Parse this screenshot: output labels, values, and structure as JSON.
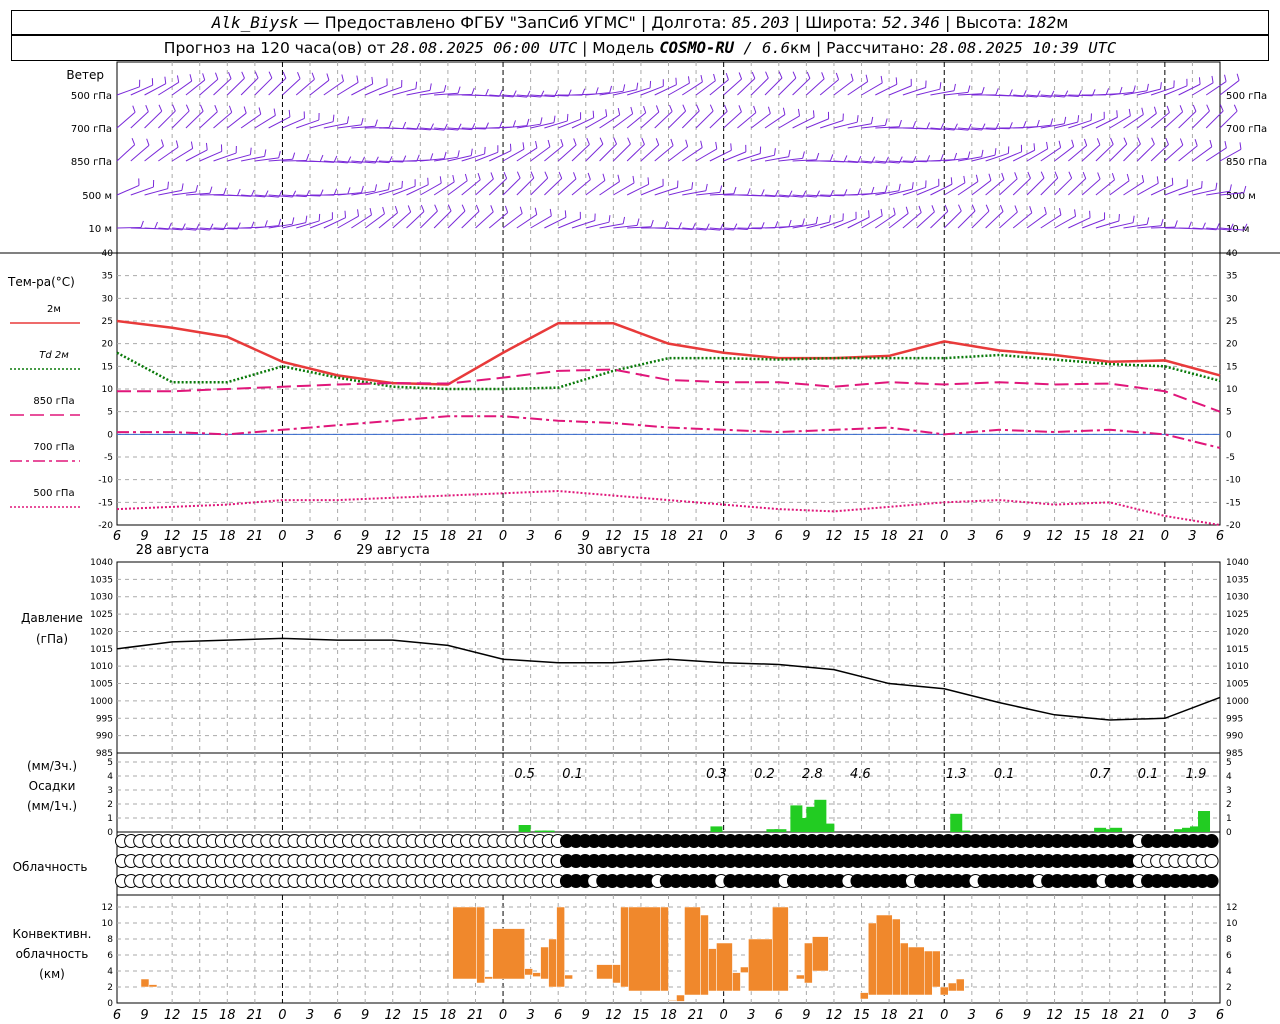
{
  "header": {
    "station": "Alk_Biysk",
    "dash": " — ",
    "provider": "Предоставлено ФГБУ \"ЗапСиб УГМС\"",
    "sep": " | ",
    "lon_label": "Долгота: ",
    "lon": "85.203",
    "lat_label": "Широта: ",
    "lat": "52.346",
    "alt_label": "Высота: ",
    "alt": "182",
    "alt_unit": "м",
    "forecast_prefix": "Прогноз на 120 часа(ов) от ",
    "forecast_time": "28.08.2025 06:00 UTC",
    "model_prefix": "Модель ",
    "model": "COSMO-RU",
    "model_res": " / 6.6",
    "model_res_unit": "км",
    "calc_prefix": "Рассчитано: ",
    "calc_time": "28.08.2025 10:39 UTC"
  },
  "chart_data": [
    {
      "type": "wind-barbs",
      "title": "Ветер",
      "levels": [
        "500 гПа",
        "700 гПа",
        "850 гПа",
        "500 м",
        "10 м"
      ],
      "color": "#7a29d9"
    },
    {
      "type": "line",
      "title": "Тем-ра(°C)",
      "ylim": [
        -20,
        40
      ],
      "yticks": [
        40,
        35,
        30,
        25,
        20,
        15,
        10,
        5,
        0,
        -5,
        -10,
        -15,
        -20
      ],
      "x_hours": [
        0,
        6,
        12,
        18,
        24,
        30,
        36,
        42,
        48,
        54,
        60,
        66,
        72,
        78,
        84,
        90,
        96,
        102,
        108,
        114,
        120
      ],
      "series": [
        {
          "name": "2м",
          "color": "#e83a3a",
          "style": "solid",
          "values": [
            25,
            23.5,
            21.5,
            16,
            13,
            11.3,
            11,
            18,
            24.5,
            24.5,
            20,
            18,
            16.8,
            16.8,
            17.3,
            20.5,
            18.5,
            17.5,
            16,
            16.3,
            13
          ]
        },
        {
          "name": "Td 2м",
          "color": "#0a7a0a",
          "style": "dotted",
          "values": [
            18,
            11.5,
            11.5,
            15,
            12.5,
            10.5,
            10,
            10,
            10.3,
            14,
            16.8,
            16.8,
            16.5,
            16.8,
            16.8,
            16.8,
            17.5,
            16.5,
            15.5,
            15,
            11.8
          ]
        },
        {
          "name": "850 гПа",
          "color": "#e0167a",
          "style": "dash",
          "values": [
            9.5,
            9.5,
            10,
            10.5,
            11,
            11.3,
            11.2,
            12.5,
            14,
            14.3,
            12,
            11.5,
            11.5,
            10.5,
            11.5,
            11,
            11.5,
            11,
            11.2,
            9.5,
            5
          ]
        },
        {
          "name": "700 гПа",
          "color": "#e0167a",
          "style": "dashdot",
          "values": [
            0.5,
            0.5,
            0,
            1,
            2,
            3,
            4,
            4,
            3,
            2.5,
            1.5,
            1,
            0.5,
            1,
            1.5,
            0,
            1,
            0.5,
            1,
            0,
            -3
          ]
        },
        {
          "name": "500 гПа",
          "color": "#e0167a",
          "style": "dotted",
          "values": [
            -16.5,
            -16,
            -15.5,
            -14.5,
            -14.5,
            -14,
            -13.5,
            -13,
            -12.5,
            -13.5,
            -14.5,
            -15.5,
            -16.5,
            -17,
            -16,
            -15,
            -14.5,
            -15.5,
            -15,
            -18,
            -20
          ]
        }
      ]
    },
    {
      "type": "line",
      "title": "Давление",
      "unit": "(гПа)",
      "ylim": [
        985,
        1040
      ],
      "yticks": [
        1040,
        1035,
        1030,
        1025,
        1020,
        1015,
        1010,
        1005,
        1000,
        995,
        990,
        985
      ],
      "series": [
        {
          "name": "",
          "color": "#000000",
          "values": [
            1015,
            1017,
            1017.5,
            1018,
            1017.5,
            1017.5,
            1016,
            1012,
            1011,
            1011,
            1012,
            1011,
            1010.5,
            1009,
            1005,
            1003.5,
            999.5,
            996,
            994.5,
            995,
            1001
          ]
        }
      ]
    },
    {
      "type": "bar",
      "title": "Осадки",
      "unit_top": "(мм/3ч.)",
      "unit_bottom": "(мм/1ч.)",
      "ylim": [
        0,
        5
      ],
      "yticks": [
        5,
        4,
        3,
        2,
        1,
        0
      ],
      "color": "#22cc22",
      "totals": [
        {
          "hour": 57,
          "label": "0.5"
        },
        {
          "hour": 63,
          "label": "0.1"
        },
        {
          "hour": 81,
          "label": "0.3"
        },
        {
          "hour": 87,
          "label": "0.2"
        },
        {
          "hour": 93,
          "label": "2.8"
        },
        {
          "hour": 99,
          "label": "4.6"
        },
        {
          "hour": 111,
          "label": "1.3"
        },
        {
          "hour": 117,
          "label": "0.1"
        },
        {
          "hour": 129,
          "label": "0.7"
        },
        {
          "hour": 135,
          "label": "0.1"
        },
        {
          "hour": 141,
          "label": "1.9"
        }
      ],
      "bars": [
        {
          "hour": 57,
          "value": 0.5
        },
        {
          "hour": 59,
          "value": 0.1
        },
        {
          "hour": 60,
          "value": 0.1
        },
        {
          "hour": 81,
          "value": 0.4
        },
        {
          "hour": 88,
          "value": 0.2
        },
        {
          "hour": 89,
          "value": 0.2
        },
        {
          "hour": 91,
          "value": 1.9
        },
        {
          "hour": 92,
          "value": 1.0
        },
        {
          "hour": 93,
          "value": 1.8
        },
        {
          "hour": 94,
          "value": 2.3
        },
        {
          "hour": 95,
          "value": 0.6
        },
        {
          "hour": 111,
          "value": 1.3
        },
        {
          "hour": 112,
          "value": 0.1
        },
        {
          "hour": 129,
          "value": 0.3
        },
        {
          "hour": 130,
          "value": 0.2
        },
        {
          "hour": 131,
          "value": 0.3
        },
        {
          "hour": 139,
          "value": 0.2
        },
        {
          "hour": 140,
          "value": 0.3
        },
        {
          "hour": 141,
          "value": 0.4
        },
        {
          "hour": 142,
          "value": 1.5
        }
      ]
    },
    {
      "type": "cloud-symbols",
      "title": "Облачность",
      "rows": 3,
      "color": "#000000"
    },
    {
      "type": "bar",
      "title": "Конвективн.\nоблачность\n(км)",
      "ylim": [
        0,
        13
      ],
      "yticks": [
        12,
        10,
        8,
        6,
        4,
        2,
        0
      ],
      "color": "#f0882c",
      "bars": [
        {
          "start": 9,
          "end": 10,
          "bottom": 2,
          "top": 3
        },
        {
          "start": 10,
          "end": 11,
          "bottom": 2,
          "top": 2.3
        },
        {
          "start": 48,
          "end": 51,
          "bottom": 3,
          "top": 12
        },
        {
          "start": 51,
          "end": 52,
          "bottom": 2.5,
          "top": 12
        },
        {
          "start": 52,
          "end": 53,
          "bottom": 3,
          "top": 3.3
        },
        {
          "start": 53,
          "end": 57,
          "bottom": 3,
          "top": 9.3
        },
        {
          "start": 57,
          "end": 58,
          "bottom": 3.5,
          "top": 4.3
        },
        {
          "start": 58,
          "end": 59,
          "bottom": 3.3,
          "top": 3.8
        },
        {
          "start": 59,
          "end": 60,
          "bottom": 3,
          "top": 7
        },
        {
          "start": 60,
          "end": 61,
          "bottom": 2,
          "top": 8
        },
        {
          "start": 61,
          "end": 62,
          "bottom": 2,
          "top": 12
        },
        {
          "start": 62,
          "end": 63,
          "bottom": 3,
          "top": 3.5
        },
        {
          "start": 66,
          "end": 68,
          "bottom": 3,
          "top": 4.8
        },
        {
          "start": 68,
          "end": 69,
          "bottom": 2.5,
          "top": 4.8
        },
        {
          "start": 69,
          "end": 70,
          "bottom": 2,
          "top": 12
        },
        {
          "start": 70,
          "end": 74,
          "bottom": 1.5,
          "top": 12
        },
        {
          "start": 74,
          "end": 75,
          "bottom": 1.5,
          "top": 12
        },
        {
          "start": 75,
          "end": 76,
          "bottom": 0.3,
          "top": 0.4
        },
        {
          "start": 76,
          "end": 77,
          "bottom": 0.2,
          "top": 1
        },
        {
          "start": 77,
          "end": 79,
          "bottom": 1,
          "top": 12
        },
        {
          "start": 79,
          "end": 80,
          "bottom": 1,
          "top": 11
        },
        {
          "start": 80,
          "end": 81,
          "bottom": 1.5,
          "top": 6.8
        },
        {
          "start": 81,
          "end": 83,
          "bottom": 1.5,
          "top": 7.5
        },
        {
          "start": 83,
          "end": 84,
          "bottom": 1.5,
          "top": 3.8
        },
        {
          "start": 84,
          "end": 85,
          "bottom": 3.8,
          "top": 4.5
        },
        {
          "start": 85,
          "end": 88,
          "bottom": 1.5,
          "top": 8
        },
        {
          "start": 88,
          "end": 90,
          "bottom": 1.5,
          "top": 12
        },
        {
          "start": 91,
          "end": 92,
          "bottom": 3,
          "top": 3.5
        },
        {
          "start": 92,
          "end": 93,
          "bottom": 2.5,
          "top": 7.5
        },
        {
          "start": 93,
          "end": 95,
          "bottom": 4,
          "top": 8.3
        },
        {
          "start": 99,
          "end": 100,
          "bottom": 0.5,
          "top": 1.3
        },
        {
          "start": 100,
          "end": 101,
          "bottom": 1,
          "top": 10
        },
        {
          "start": 101,
          "end": 103,
          "bottom": 1,
          "top": 11
        },
        {
          "start": 103,
          "end": 104,
          "bottom": 1,
          "top": 10.5
        },
        {
          "start": 104,
          "end": 105,
          "bottom": 1,
          "top": 7.5
        },
        {
          "start": 105,
          "end": 107,
          "bottom": 1,
          "top": 7
        },
        {
          "start": 107,
          "end": 108,
          "bottom": 1,
          "top": 6.5
        },
        {
          "start": 108,
          "end": 109,
          "bottom": 2,
          "top": 6.5
        },
        {
          "start": 109,
          "end": 110,
          "bottom": 1,
          "top": 2
        },
        {
          "start": 110,
          "end": 111,
          "bottom": 1.5,
          "top": 2.5
        },
        {
          "start": 111,
          "end": 112,
          "bottom": 1.5,
          "top": 3
        }
      ]
    }
  ],
  "time_axis": {
    "hour_labels": [
      "6",
      "9",
      "12",
      "15",
      "18",
      "21",
      "0",
      "3",
      "6",
      "9",
      "12",
      "15",
      "18",
      "21",
      "0",
      "3",
      "6",
      "9",
      "12",
      "15",
      "18",
      "21",
      "0",
      "3",
      "6",
      "9",
      "12",
      "15",
      "18",
      "21",
      "0",
      "3",
      "6",
      "9",
      "12",
      "15",
      "18",
      "21",
      "0",
      "3",
      "6",
      "9",
      "12"
    ],
    "hours_range": [
      0,
      120
    ],
    "midnights": [
      18,
      42,
      66,
      90,
      114
    ],
    "day_labels": [
      {
        "hour": 0,
        "label": "28 августа"
      },
      {
        "hour": 24,
        "label": "29 августа"
      },
      {
        "hour": 48,
        "label": "30 августа"
      }
    ]
  }
}
